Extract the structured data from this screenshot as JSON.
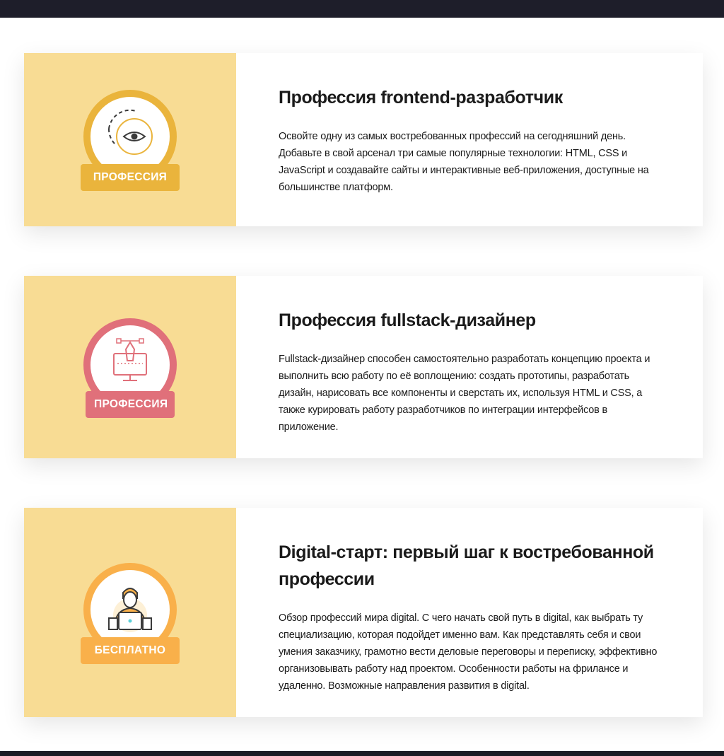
{
  "cards": [
    {
      "badge": "ПРОФЕССИЯ",
      "badge_color": "#eab43c",
      "title": "Профессия frontend-разработчик",
      "description": "Освойте одну из самых востребованных профессий на сегодняшний день. Добавьте в свой арсенал три самые популярные технологии: HTML, CSS и JavaScript и создавайте сайты и интерактивные веб-приложения, доступные на большинстве платформ.",
      "icon": "eye-icon"
    },
    {
      "badge": "ПРОФЕССИЯ",
      "badge_color": "#e0707a",
      "title": "Профессия fullstack-дизайнер",
      "description": "Fullstack-дизайнер способен самостоятельно разработать концепцию проекта и выполнить всю работу по её воплощению: создать прототипы, разработать дизайн, нарисовать все компоненты и сверстать их, используя HTML и CSS, а также курировать работу разработчиков по интеграции интерфейсов в приложение.",
      "icon": "pen-tool-monitor-icon"
    },
    {
      "badge": "БЕСПЛАТНО",
      "badge_color": "#f9b04a",
      "title": "Digital-старт: первый шаг к востребованной профессии",
      "description": "Обзор профессий мира digital. С чего начать свой путь в digital, как выбрать ту специализацию, которая подойдет именно вам. Как представлять себя и свои умения заказчику, грамотно вести деловые переговоры и переписку, эффективно организовывать работу над проектом. Особенности работы на фрилансе и удаленно. Возможные направления развития в digital.",
      "icon": "person-laptop-icon"
    }
  ]
}
